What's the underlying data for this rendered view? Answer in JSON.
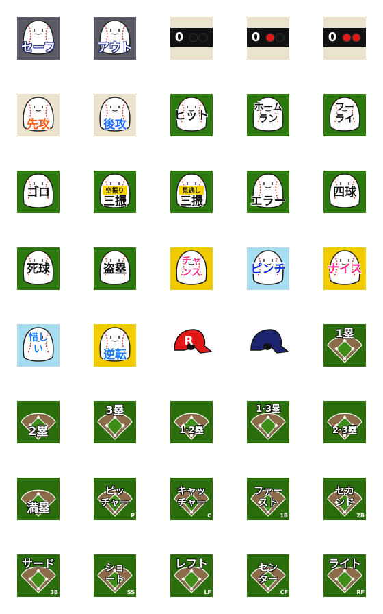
{
  "stickers": [
    {
      "kind": "ball",
      "bg": "#5a5a66",
      "label": "セーフ",
      "color": "#ffffff",
      "stroke": "#1c2a8c",
      "ls": "bottom"
    },
    {
      "kind": "ball",
      "bg": "#5a5a66",
      "label": "アウト",
      "color": "#ffffff",
      "stroke": "#1c2a8c",
      "ls": "bottom"
    },
    {
      "kind": "count",
      "outs": 0,
      "label": "0"
    },
    {
      "kind": "count",
      "outs": 1,
      "label": "0"
    },
    {
      "kind": "count",
      "outs": 2,
      "label": "0"
    },
    {
      "kind": "ball",
      "bg": "#ece3cc",
      "label": "先攻",
      "color": "#ff5a12",
      "ls": "bottom"
    },
    {
      "kind": "ball",
      "bg": "#ece3cc",
      "label": "後攻",
      "color": "#1a6cff",
      "ls": "bottom"
    },
    {
      "kind": "ball",
      "bg": "#2c7a0e",
      "label": "ヒット",
      "color": "#111111",
      "ls": "mid"
    },
    {
      "kind": "ball",
      "bg": "#2c7a0e",
      "label": "ホーム\nラン",
      "color": "#111111",
      "ls": "two"
    },
    {
      "kind": "ball",
      "bg": "#2c7a0e",
      "label": "フー\nライ",
      "color": "#111111",
      "ls": "two"
    },
    {
      "kind": "ball",
      "bg": "#2c7a0e",
      "label": "ゴロ",
      "color": "#111111",
      "ls": "mid"
    },
    {
      "kind": "ball",
      "bg": "#2c7a0e",
      "label": "三振",
      "small": "空振り",
      "color": "#111111",
      "ls": "bottom"
    },
    {
      "kind": "ball",
      "bg": "#2c7a0e",
      "label": "三振",
      "small": "見逃し",
      "color": "#111111",
      "ls": "bottom"
    },
    {
      "kind": "ball",
      "bg": "#2c7a0e",
      "label": "エラー",
      "color": "#111111",
      "ls": "bottom"
    },
    {
      "kind": "ball",
      "bg": "#2c7a0e",
      "label": "四球",
      "color": "#111111",
      "ls": "mid"
    },
    {
      "kind": "ball",
      "bg": "#2c7a0e",
      "label": "死球",
      "color": "#111111",
      "ls": "mid"
    },
    {
      "kind": "ball",
      "bg": "#2c7a0e",
      "label": "盗塁",
      "color": "#111111",
      "ls": "mid"
    },
    {
      "kind": "ball",
      "bg": "#f2cc00",
      "label": "チャ\nンス",
      "color": "#ff2a8a",
      "ls": "two"
    },
    {
      "kind": "ball",
      "bg": "#a8dcf0",
      "label": "ピンチ",
      "color": "#1030e0",
      "ls": "mid"
    },
    {
      "kind": "ball",
      "bg": "#f2cc00",
      "label": "ナイス",
      "color": "#ff2a8a",
      "ls": "mid"
    },
    {
      "kind": "ball",
      "bg": "#a8dcf0",
      "label": "惜し\nい",
      "color": "#1a7cff",
      "ls": "two"
    },
    {
      "kind": "ball",
      "bg": "#f2cc00",
      "label": "逆転",
      "color": "#1a7cff",
      "ls": "bottom"
    },
    {
      "kind": "helmet",
      "color": "#e01818",
      "label": "R"
    },
    {
      "kind": "helmet",
      "color": "#1c2470",
      "label": ""
    },
    {
      "kind": "field",
      "label": "1塁",
      "pos": "top",
      "sub": ""
    },
    {
      "kind": "field",
      "label": "2塁",
      "pos": "bottom",
      "sub": ""
    },
    {
      "kind": "field",
      "label": "3塁",
      "pos": "top",
      "sub": ""
    },
    {
      "kind": "field",
      "label": "1·2塁",
      "pos": "bottom",
      "sub": ""
    },
    {
      "kind": "field",
      "label": "1·3塁",
      "pos": "top",
      "sub": ""
    },
    {
      "kind": "field",
      "label": "2·3塁",
      "pos": "bottom",
      "sub": ""
    },
    {
      "kind": "field",
      "label": "満塁",
      "pos": "bottom",
      "sub": ""
    },
    {
      "kind": "field",
      "label": "ピッ\nチャー",
      "pos": "two",
      "sub": "P"
    },
    {
      "kind": "field",
      "label": "キャッ\nチャー",
      "pos": "two",
      "sub": "C"
    },
    {
      "kind": "field",
      "label": "ファー\nスト",
      "pos": "two",
      "sub": "1B"
    },
    {
      "kind": "field",
      "label": "セカ\nンド",
      "pos": "two",
      "sub": "2B"
    },
    {
      "kind": "field",
      "label": "サード",
      "pos": "top",
      "sub": "3B"
    },
    {
      "kind": "field",
      "label": "ショ\nート",
      "pos": "two",
      "sub": "SS"
    },
    {
      "kind": "field",
      "label": "レフト",
      "pos": "top",
      "sub": "LF"
    },
    {
      "kind": "field",
      "label": "セン\nター",
      "pos": "two",
      "sub": "CF"
    },
    {
      "kind": "field",
      "label": "ライト",
      "pos": "top",
      "sub": "RF"
    }
  ]
}
